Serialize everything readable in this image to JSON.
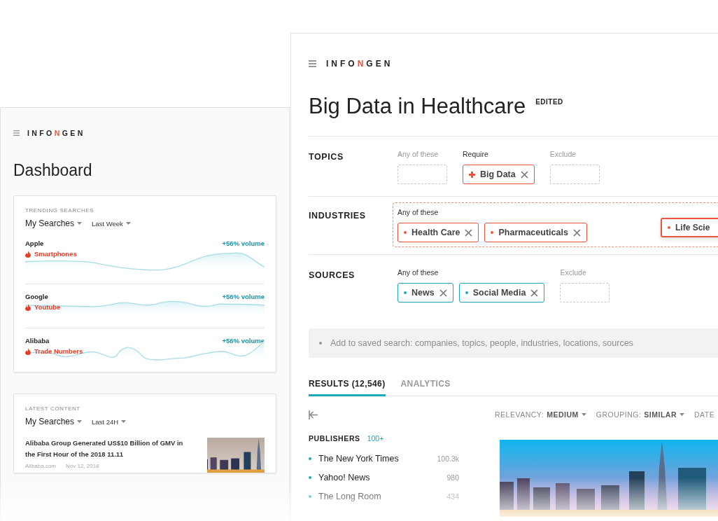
{
  "left_window": {
    "logo": {
      "before": "INFO",
      "accent": "N",
      "after": "GEN"
    },
    "title": "Dashboard",
    "trending": {
      "heading": "TRENDING SEARCHES",
      "scope": "My Searches",
      "period": "Last Week",
      "items": [
        {
          "name": "Apple",
          "topic": "Smartphones",
          "change": "+56% volume"
        },
        {
          "name": "Google",
          "topic": "Youtube",
          "change": "+56% volume"
        },
        {
          "name": "Alibaba",
          "topic": "Trade Numbers",
          "change": "+56% volume"
        }
      ]
    },
    "latest": {
      "heading": "LATEST CONTENT",
      "scope": "My Searches",
      "period": "Last 24H",
      "article": {
        "title": "Alibaba Group Generated US$10 Billion of GMV in the First Hour of the 2018 11.11",
        "source": "Alibaba.com",
        "date": "Nov 12, 2018"
      }
    }
  },
  "main_window": {
    "logo": {
      "before": "INFO",
      "accent": "N",
      "after": "GEN"
    },
    "title": "Big Data in Healthcare",
    "badge": "EDITED",
    "sections": [
      {
        "label": "TOPICS",
        "groups": [
          {
            "label": "Any of these",
            "kind": "drop-zone"
          },
          {
            "label": "Require",
            "kind": "chips",
            "chips": [
              {
                "label": "Big Data",
                "kind": "plus",
                "color": "#e8553f"
              }
            ]
          },
          {
            "label": "Exclude",
            "kind": "drop-zone"
          }
        ]
      },
      {
        "label": "INDUSTRIES",
        "groups": [
          {
            "label": "Any of these",
            "kind": "outlined-chips",
            "chips": [
              {
                "label": "Health Care",
                "kind": "dot",
                "color": "#e8553f"
              },
              {
                "label": "Pharmaceuticals",
                "kind": "dot",
                "color": "#e8553f"
              }
            ]
          }
        ],
        "floating_chip": {
          "label": "Life Scie",
          "color": "#e8553f"
        }
      },
      {
        "label": "SOURCES",
        "groups": [
          {
            "label": "Any of these",
            "kind": "chips",
            "chips": [
              {
                "label": "News",
                "kind": "dot",
                "color": "#1fa7bd"
              },
              {
                "label": "Social Media",
                "kind": "dot",
                "color": "#1fa7bd"
              }
            ]
          },
          {
            "label": "Exclude",
            "kind": "drop-zone"
          }
        ]
      }
    ],
    "search": {
      "placeholder": "Add to saved search: companies, topics, people, industries, locations, sources"
    },
    "tabs": [
      {
        "label": "RESULTS (12,546)",
        "selected": true
      },
      {
        "label": "ANALYTICS",
        "selected": false
      }
    ],
    "filters": [
      {
        "label": "RELEVANCY:",
        "value": "MEDIUM"
      },
      {
        "label": "GROUPING:",
        "value": "SIMILAR"
      },
      {
        "label": "DATE"
      }
    ],
    "publishers": {
      "heading": "PUBLISHERS",
      "count": "100+",
      "items": [
        {
          "name": "The New York Times",
          "count": "100.3k"
        },
        {
          "name": "Yahoo! News",
          "count": "980"
        },
        {
          "name": "The Long Room",
          "count": "434"
        }
      ]
    }
  }
}
